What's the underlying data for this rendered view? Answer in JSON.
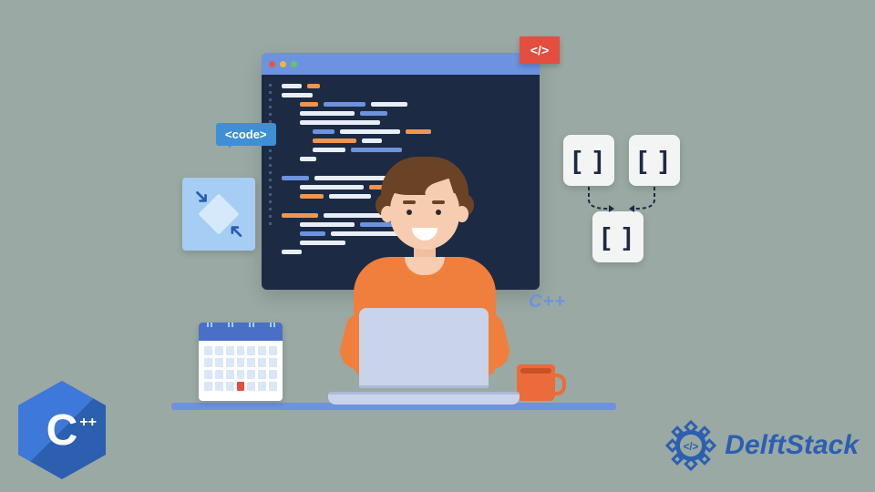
{
  "badge_red_label": "</>",
  "badge_code_label": "<code>",
  "bracket_glyph": "[ ]",
  "cpp_float_label": "C++",
  "cpp_logo_letter": "C",
  "cpp_logo_plusses": "++",
  "brand_name": "DelftStack",
  "colors": {
    "bg": "#9aa9a3",
    "window_dark": "#1c2a44",
    "window_chrome": "#6d92e0",
    "accent_orange": "#f07f3e",
    "accent_red": "#e34e3e",
    "accent_blue": "#3e8fd6",
    "brand_blue": "#2d5fb0"
  },
  "calendar": {
    "rows": 4,
    "cols": 7,
    "marked_index": 24
  }
}
